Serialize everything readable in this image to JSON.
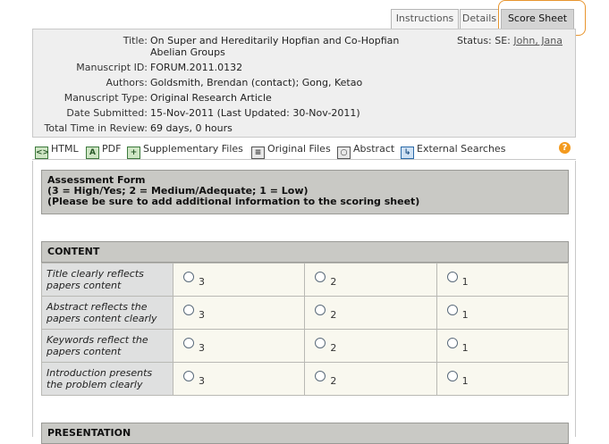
{
  "tabs": [
    {
      "label": "Instructions"
    },
    {
      "label": "Details"
    },
    {
      "label": "Score Sheet"
    }
  ],
  "info": {
    "title_label": "Title:",
    "title_value": "On Super and Hereditarily Hopfian and Co-Hopfian Abelian Groups",
    "status_label": "Status: SE:",
    "status_link": "John, Jana",
    "manuscript_id_label": "Manuscript ID:",
    "manuscript_id_value": "FORUM.2011.0132",
    "authors_label": "Authors:",
    "authors_value": "Goldsmith, Brendan (contact); Gong, Ketao",
    "type_label": "Manuscript Type:",
    "type_value": "Original Research Article",
    "submitted_label": "Date Submitted:",
    "submitted_value": "15-Nov-2011 (Last Updated: 30-Nov-2011)",
    "time_label": "Total Time in Review:",
    "time_value": "69 days, 0 hours"
  },
  "toolbar": {
    "html": "HTML",
    "pdf": "PDF",
    "supplementary": "Supplementary Files",
    "original": "Original Files",
    "abstract": "Abstract",
    "external": "External Searches",
    "help": "?"
  },
  "assessment": {
    "line1": "Assessment Form",
    "line2": "(3 = High/Yes; 2 = Medium/Adequate; 1 = Low)",
    "line3": "(Please be sure to add additional information to the scoring sheet)"
  },
  "sections": {
    "content": {
      "heading": "CONTENT",
      "questions": [
        {
          "text": "Title clearly reflects papers content",
          "options": [
            "3",
            "2",
            "1"
          ]
        },
        {
          "text": "Abstract reflects the papers content clearly",
          "options": [
            "3",
            "2",
            "1"
          ]
        },
        {
          "text": "Keywords reflect the papers content",
          "options": [
            "3",
            "2",
            "1"
          ]
        },
        {
          "text": "Introduction presents the problem clearly",
          "options": [
            "3",
            "2",
            "1"
          ]
        }
      ]
    },
    "presentation": {
      "heading": "PRESENTATION"
    }
  },
  "colors": {
    "accent_highlight": "#e8952e",
    "header_bar": "#c9c9c5",
    "info_bg": "#efefef"
  }
}
